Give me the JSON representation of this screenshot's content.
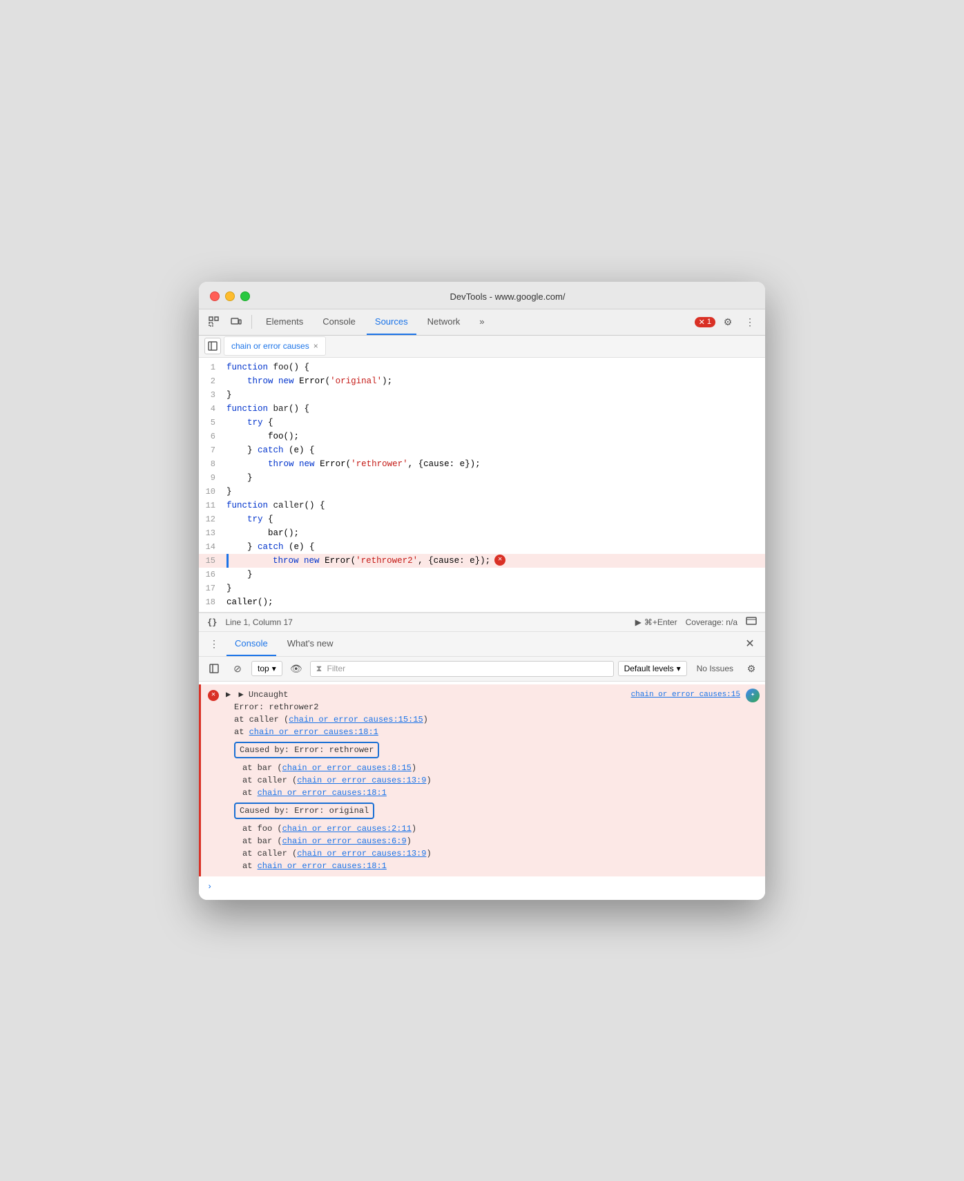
{
  "titlebar": {
    "title": "DevTools - www.google.com/"
  },
  "toolbar": {
    "tabs": [
      {
        "id": "elements",
        "label": "Elements",
        "active": false
      },
      {
        "id": "console",
        "label": "Console",
        "active": false
      },
      {
        "id": "sources",
        "label": "Sources",
        "active": true
      },
      {
        "id": "network",
        "label": "Network",
        "active": false
      },
      {
        "id": "more",
        "label": "»",
        "active": false
      }
    ],
    "error_count": "1",
    "settings_label": "⚙",
    "more_label": "⋮"
  },
  "file_tab": {
    "name": "chain or error causes",
    "close": "×"
  },
  "code": {
    "lines": [
      {
        "num": 1,
        "content": "function foo() {",
        "highlighted": false
      },
      {
        "num": 2,
        "content": "    throw new Error('original');",
        "highlighted": false
      },
      {
        "num": 3,
        "content": "}",
        "highlighted": false
      },
      {
        "num": 4,
        "content": "function bar() {",
        "highlighted": false
      },
      {
        "num": 5,
        "content": "    try {",
        "highlighted": false
      },
      {
        "num": 6,
        "content": "        foo();",
        "highlighted": false
      },
      {
        "num": 7,
        "content": "    } catch (e) {",
        "highlighted": false
      },
      {
        "num": 8,
        "content": "        throw new Error('rethrower', {cause: e});",
        "highlighted": false
      },
      {
        "num": 9,
        "content": "    }",
        "highlighted": false
      },
      {
        "num": 10,
        "content": "}",
        "highlighted": false
      },
      {
        "num": 11,
        "content": "function caller() {",
        "highlighted": false
      },
      {
        "num": 12,
        "content": "    try {",
        "highlighted": false
      },
      {
        "num": 13,
        "content": "        bar();",
        "highlighted": false
      },
      {
        "num": 14,
        "content": "    } catch (e) {",
        "highlighted": false
      },
      {
        "num": 15,
        "content": "        throw new Error('rethrower2', {cause: e});",
        "highlighted": true,
        "error": true
      },
      {
        "num": 16,
        "content": "    }",
        "highlighted": false
      },
      {
        "num": 17,
        "content": "}",
        "highlighted": false
      },
      {
        "num": 18,
        "content": "caller();",
        "highlighted": false
      }
    ]
  },
  "status_bar": {
    "position": "Line 1, Column 17",
    "run_label": "⌘+Enter",
    "coverage": "Coverage: n/a",
    "curly_braces": "{}"
  },
  "console": {
    "tabs": [
      {
        "id": "console",
        "label": "Console",
        "active": true
      },
      {
        "id": "whats-new",
        "label": "What's new",
        "active": false
      }
    ],
    "filter": {
      "top_label": "top",
      "eye_label": "👁",
      "filter_label": "Filter",
      "levels_label": "Default levels",
      "no_issues_label": "No Issues"
    },
    "output": {
      "error_header": "▶ Uncaught",
      "file_link_header": "chain or error causes:15",
      "error_line1": "Error: rethrower2",
      "error_line2": "    at caller (chain or error causes:15:15)",
      "error_line3": "    at chain or error causes:18:1",
      "caused_by_1": "Caused by: Error: rethrower",
      "caused_by_1_detail1": "    at bar (chain or error causes:8:15)",
      "caused_by_1_detail2": "    at caller (chain or error causes:13:9)",
      "caused_by_1_detail3": "    at chain or error causes:18:1",
      "caused_by_2": "Caused by: Error: original",
      "caused_by_2_detail1": "    at foo (chain or error causes:2:11)",
      "caused_by_2_detail2": "    at bar (chain or error causes:6:9)",
      "caused_by_2_detail3": "    at caller (chain or error causes:13:9)",
      "caused_by_2_detail4": "    at chain or error causes:18:1",
      "links": {
        "header_link": "chain or error causes:15",
        "link_15_15": "chain or error causes:15:15",
        "link_18_1_a": "chain or error causes:18:1",
        "link_8_15": "chain or error causes:8:15",
        "link_13_9_a": "chain or error causes:13:9",
        "link_18_1_b": "chain or error causes:18:1",
        "link_2_11": "chain or error causes:2:11",
        "link_6_9": "chain or error causes:6:9",
        "link_13_9_b": "chain or error causes:13:9",
        "link_18_1_c": "chain or error causes:18:1"
      }
    }
  }
}
